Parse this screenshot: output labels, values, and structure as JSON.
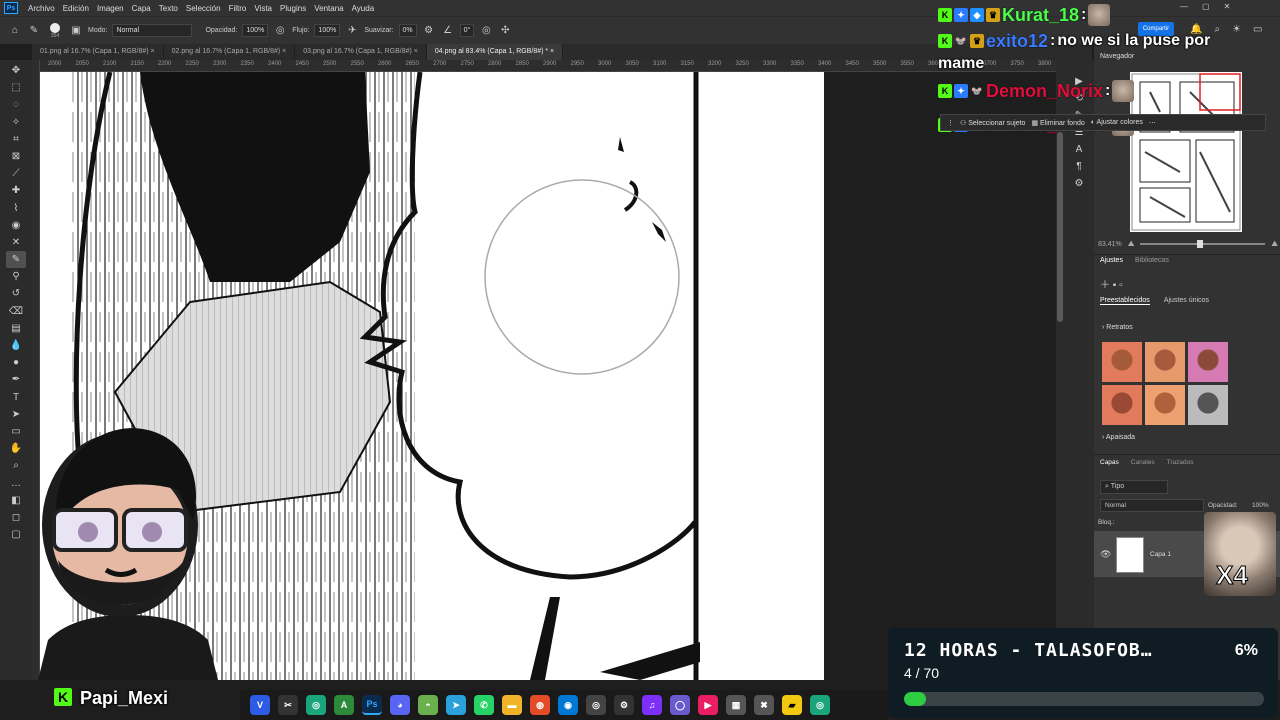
{
  "menu": [
    "Archivo",
    "Edición",
    "Imagen",
    "Capa",
    "Texto",
    "Selección",
    "Filtro",
    "Vista",
    "Plugins",
    "Ventana",
    "Ayuda"
  ],
  "options": {
    "brush_size": "354",
    "mode_label": "Modo:",
    "mode_value": "Normal",
    "opacity_label": "Opacidad:",
    "opacity_value": "100%",
    "flow_label": "Flujo:",
    "flow_value": "100%",
    "smooth_label": "Suavizar:",
    "smooth_value": "0%",
    "angle_value": "0°"
  },
  "share_label": "Compartir",
  "tabs": [
    "01.png al 16.7% (Capa 1, RGB/8#)",
    "02.png al 16.7% (Capa 1, RGB/8#)",
    "03.png al 16.7% (Capa 1, RGB/8#)",
    "04.png al 83.4% (Capa 1, RGB/8#) *"
  ],
  "ruler_ticks": [
    "2000",
    "2050",
    "2100",
    "2150",
    "2200",
    "2250",
    "2300",
    "2350",
    "2400",
    "2450",
    "2500",
    "2550",
    "2600",
    "2650",
    "2700",
    "2750",
    "2800",
    "2850",
    "2900",
    "2950",
    "3000",
    "3050",
    "3100",
    "3150",
    "3200",
    "3250",
    "3300",
    "3350",
    "3400",
    "3450",
    "3500",
    "3550",
    "3600",
    "3650",
    "3700",
    "3750",
    "3800"
  ],
  "context_bar": {
    "select_subject": "Seleccionar sujeto",
    "remove_bg": "Eliminar fondo",
    "adjust_colors": "Ajustar colores"
  },
  "navigator": {
    "title": "Navegador",
    "zoom": "83.41%"
  },
  "adjustments": {
    "tab1": "Ajustes",
    "tab2": "Bibliotecas",
    "sub1": "Preestablecidos",
    "sub2": "Ajustes únicos",
    "group1": "Retratos",
    "group2": "Apaisada"
  },
  "layers": {
    "tab1": "Capas",
    "tab2": "Canales",
    "tab3": "Trazados",
    "filter": "Tipo",
    "blend": "Normal",
    "opacity_label": "Opacidad:",
    "opacity_value": "100%",
    "lock_label": "Bloq.:",
    "layer_name": "Capa 1"
  },
  "chat": [
    {
      "user": "Kurat_18",
      "sep": ":",
      "msg": "",
      "color": "#4cff4c"
    },
    {
      "user": "exito12",
      "sep": ":",
      "msg": "no we si la puse por",
      "color": "#3a7bff"
    },
    {
      "user": "",
      "sep": "",
      "msg": "mame",
      "color": "#fff"
    },
    {
      "user": "Demon_Norix",
      "sep": ":",
      "msg": "",
      "color": "#e0103c"
    },
    {
      "user": "Demon_Norix",
      "sep": ":",
      "msg": "",
      "color": "#e0103c"
    }
  ],
  "multiplier": "X4",
  "goal": {
    "title": "12 HORAS - TALASOFOB…",
    "percent": "6%",
    "count": "4 / 70",
    "progress": 0.06
  },
  "streamer_name": "Papi_Mexi",
  "colors": {
    "kick_green": "#53fc18",
    "ps_blue": "#31a8ff",
    "progress": "#2ecc40"
  }
}
